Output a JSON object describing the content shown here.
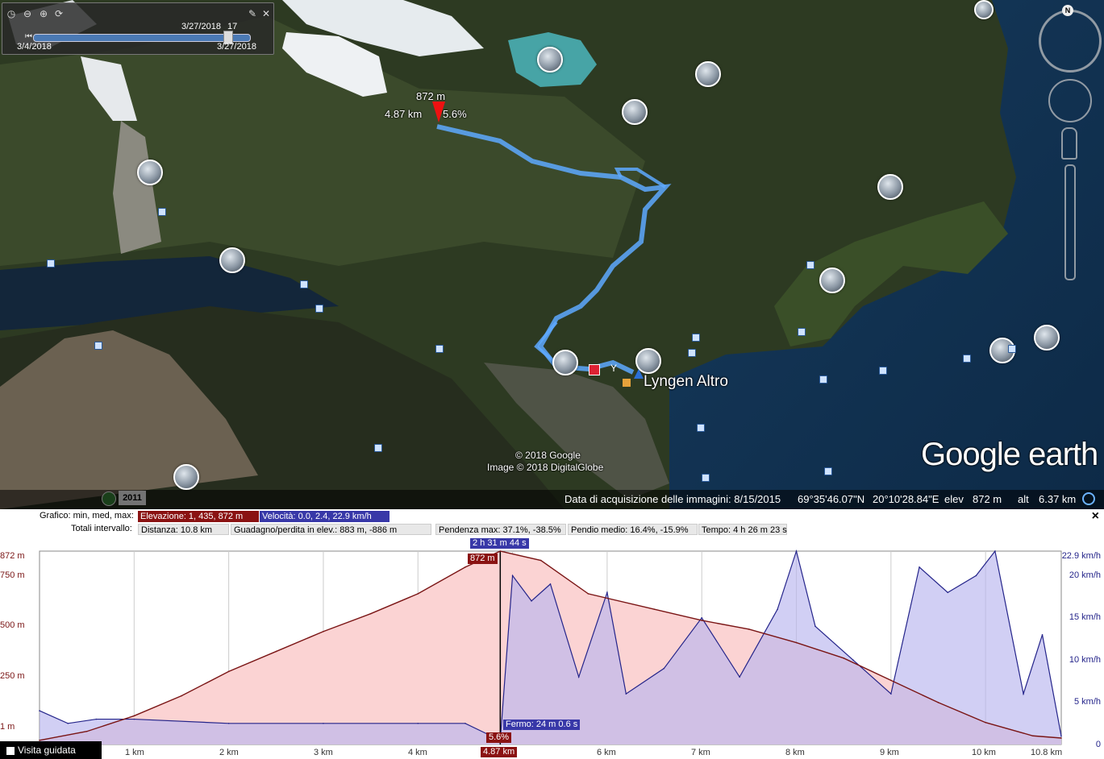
{
  "time_slider": {
    "current": "3/27/2018",
    "current_hour": "17",
    "start": "3/4/2018",
    "end": "3/27/2018"
  },
  "route": {
    "elevation_marker": "872 m",
    "distance_marker": "4.87 km",
    "slope_marker": "5.6%",
    "place_label": "Lyngen Altro"
  },
  "credits": {
    "google": "© 2018 Google",
    "image": "Image © 2018 DigitalGlobe",
    "logo": "Google earth"
  },
  "historic_year": "2011",
  "status_bar": {
    "acquisition": "Data di acquisizione delle immagini: 8/15/2015",
    "lat": "69°35'46.07\"N",
    "lon": "20°10'28.84\"E",
    "elev_label": "elev",
    "elev_value": "872 m",
    "alt_label": "alt",
    "alt_value": "6.37 km"
  },
  "nav_controls": {
    "north": "N"
  },
  "profile": {
    "row1_label": "Grafico: min, med, max:",
    "elevation": "Elevazione: 1, 435, 872 m",
    "speed": "Velocità: 0.0, 2.4, 22.9 km/h",
    "row2_label": "Totali intervallo:",
    "distance": "Distanza: 10.8 km",
    "gain_loss": "Guadagno/perdita in elev.: 883 m, -886 m",
    "max_slope": "Pendenza max: 37.1%, -38.5%",
    "avg_slope": "Pendio medio: 16.4%, -15.9%",
    "time": "Tempo: 4 h 26 m 23 s",
    "close": "×",
    "cursor_time": "2 h 31 m 44 s",
    "cursor_elev": "872 m",
    "cursor_slope": "5.6%",
    "cursor_dist": "4.87 km",
    "stop": "Fermo: 24 m 0.6 s",
    "tour_button": "Visita guidata",
    "left_axis": [
      "872 m",
      "750 m",
      "500 m",
      "250 m",
      "1 m"
    ],
    "right_axis": [
      "22.9 km/h",
      "20 km/h",
      "15 km/h",
      "10 km/h",
      "5 km/h",
      "0"
    ],
    "x_ticks": [
      "1 km",
      "2 km",
      "3 km",
      "4 km",
      "6 km",
      "7 km",
      "8 km",
      "9 km",
      "10 km",
      "10.8 km"
    ]
  },
  "chart_data": {
    "type": "area",
    "xlabel": "",
    "ylabel": "",
    "xlim": [
      0,
      10.8
    ],
    "ylim": [
      1,
      872
    ],
    "series": [
      {
        "name": "Elevazione",
        "color": "#7a1515",
        "x": [
          0,
          0.5,
          1,
          1.5,
          2,
          2.5,
          3,
          3.5,
          4,
          4.5,
          4.87,
          5.3,
          5.8,
          6.5,
          7,
          7.5,
          8,
          8.5,
          9,
          9.5,
          10,
          10.5,
          10.8
        ],
        "values": [
          20,
          60,
          130,
          220,
          330,
          420,
          510,
          590,
          680,
          800,
          872,
          830,
          680,
          610,
          560,
          520,
          460,
          390,
          290,
          190,
          100,
          40,
          30
        ]
      },
      {
        "name": "Velocità",
        "color": "#24248a",
        "unit": "km/h",
        "x": [
          0,
          0.3,
          0.6,
          1,
          2,
          3,
          4,
          4.5,
          4.87,
          5.0,
          5.2,
          5.4,
          5.7,
          6.0,
          6.2,
          6.6,
          7.0,
          7.4,
          7.8,
          8.0,
          8.2,
          8.6,
          9.0,
          9.3,
          9.6,
          9.9,
          10.1,
          10.4,
          10.6,
          10.8
        ],
        "values": [
          4,
          2.5,
          3,
          3,
          2.5,
          2.5,
          2.5,
          2.5,
          0.5,
          20,
          17,
          19,
          8,
          18,
          6,
          9,
          15,
          8,
          16,
          22.9,
          14,
          10,
          6,
          21,
          18,
          20,
          22.9,
          6,
          13,
          1
        ]
      }
    ]
  }
}
